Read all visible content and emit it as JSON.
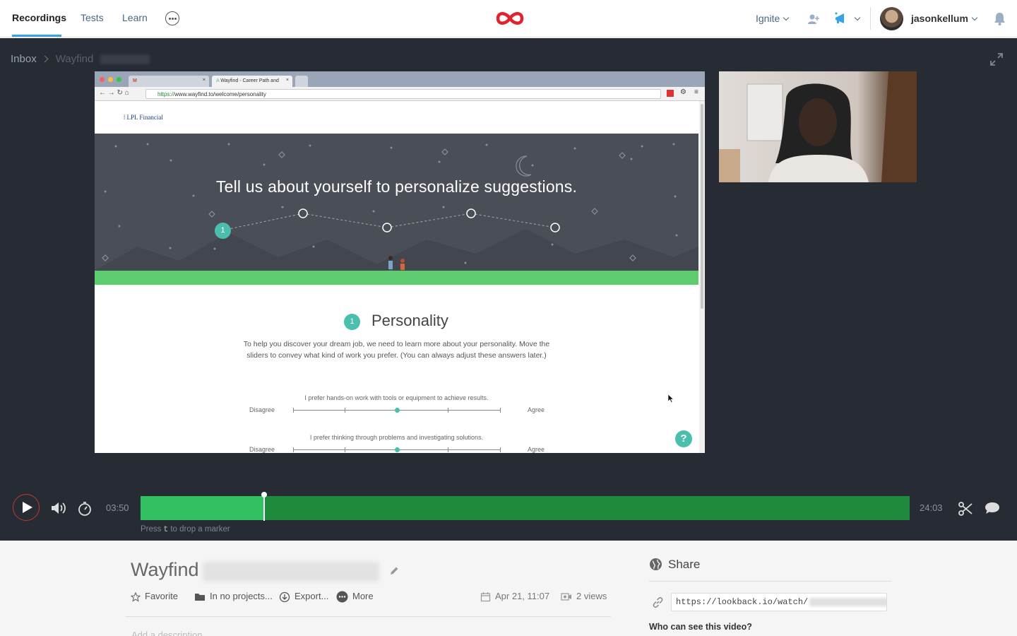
{
  "nav": {
    "tabs": [
      {
        "label": "Recordings",
        "active": true
      },
      {
        "label": "Tests",
        "active": false
      },
      {
        "label": "Learn",
        "active": false
      }
    ],
    "org": "Ignite",
    "user": "jasonkellum",
    "brand_color": "#e0232f",
    "accent_color": "#35a4e5"
  },
  "breadcrumb": {
    "root": "Inbox",
    "current": "Wayfind"
  },
  "screen": {
    "browser": {
      "tab1": "",
      "tab2": "Wayfind - Career Path and",
      "url_secure": "https://",
      "url_rest": "www.wayfind.to/welcome/personality"
    },
    "page": {
      "logo_text": "LPL Financial",
      "hero_title": "Tell us about yourself to personalize suggestions.",
      "step_number": "1",
      "section_title": "Personality",
      "section_desc": "To help you discover your dream job, we need to learn more about your personality. Move the sliders to convey what kind of work you prefer. (You can always adjust these answers later.)",
      "questions": [
        {
          "text": "I prefer hands-on work with tools or equipment to achieve results.",
          "left": "Disagree",
          "right": "Agree",
          "value": 0.5
        },
        {
          "text": "I prefer thinking through problems and investigating solutions.",
          "left": "Disagree",
          "right": "Agree",
          "value": 0.5
        }
      ],
      "help_label": "?"
    }
  },
  "player": {
    "current_time": "03:50",
    "total_time": "24:03",
    "progress": 0.16,
    "hint_prefix": "Press",
    "hint_key": "t",
    "hint_suffix": "to drop a marker"
  },
  "recording": {
    "title": "Wayfind",
    "actions": {
      "favorite": "Favorite",
      "projects": "In no projects...",
      "export": "Export...",
      "more": "More"
    },
    "date": "Apr 21, 11:07",
    "views": "2 views",
    "add_description": "Add a description"
  },
  "share": {
    "title": "Share",
    "url_prefix": "https://lookback.io/watch/",
    "who_can_see": "Who can see this video?"
  }
}
